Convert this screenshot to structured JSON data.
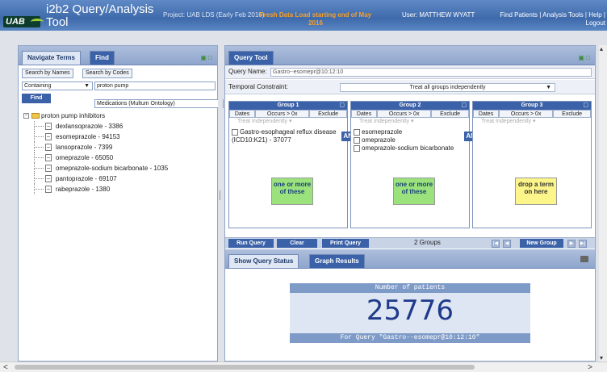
{
  "header": {
    "logo_text": "UAB",
    "app_title": "i2b2 Query/Analysis Tool",
    "project": "Project: UAB LDS (Early Feb 2016)",
    "fresh_notice": "Fresh Data Load starting end of May 2016",
    "user": "User: MATTHEW WYATT",
    "links": [
      "Find Patients",
      "Analysis Tools",
      "Help",
      "Logout"
    ]
  },
  "left_panel": {
    "tabs": [
      "Navigate Terms",
      "Find"
    ],
    "search_tabs": [
      "Search by Names",
      "Search by Codes"
    ],
    "match_mode": "Containing",
    "search_value": "proton pump",
    "find_label": "Find",
    "ontology": "Medications (Multum Ontology)",
    "tree_root": "proton pump inhibitors",
    "tree_items": [
      "dexlansoprazole - 3386",
      "esomeprazole - 94153",
      "lansoprazole - 7399",
      "omeprazole - 65050",
      "omeprazole-sodium bicarbonate - 1035",
      "pantoprazole - 69107",
      "rabeprazole - 1380"
    ]
  },
  "query_tool": {
    "tab": "Query Tool",
    "query_name_label": "Query Name:",
    "query_name": "Gastro--esomepr@10:12:10",
    "temporal_label": "Temporal Constraint:",
    "temporal_value": "Treat all groups independently",
    "group_tools": [
      "Dates",
      "Occurs > 0x",
      "Exclude"
    ],
    "treat_independently": "Treat Independently",
    "groups": [
      {
        "title": "Group 1",
        "items": [
          "Gastro-esophageal reflux disease (ICD10:K21) - 37077"
        ],
        "drop": "one or more of these"
      },
      {
        "title": "Group 2",
        "items": [
          "esomeprazole",
          "omeprazole",
          "omeprazole-sodium bicarbonate"
        ],
        "drop": "one or more of these"
      },
      {
        "title": "Group 3",
        "items": [],
        "drop": "drop a term on here"
      }
    ],
    "and_label": "AND",
    "buttons": {
      "run": "Run Query",
      "clear": "Clear",
      "print": "Print Query",
      "new_group": "New Group"
    },
    "groups_count": "2 Groups",
    "result_tabs": [
      "Show Query Status",
      "Graph Results"
    ],
    "result": {
      "heading": "Number of patients",
      "count": "25776",
      "footer": "For Query \"Gastro--esomepr@10:12:10\""
    }
  }
}
